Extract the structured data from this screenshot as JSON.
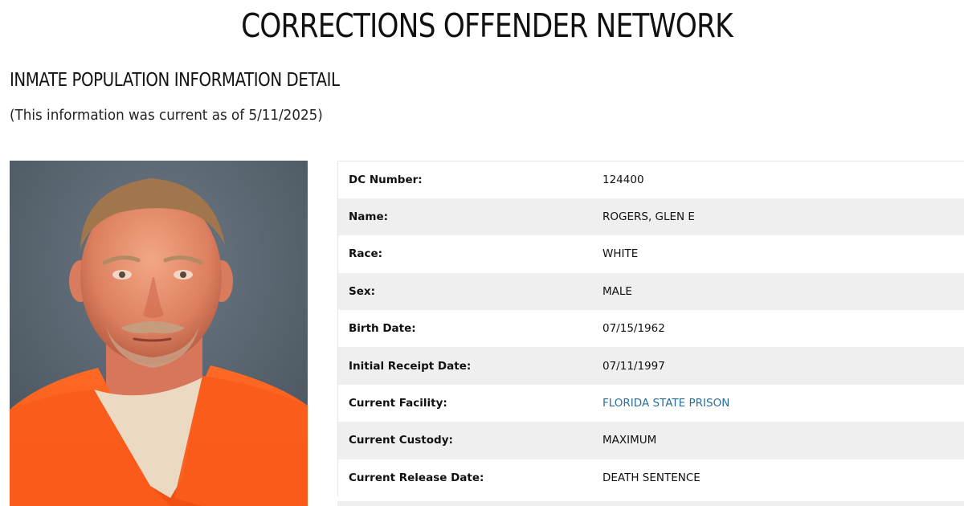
{
  "header": {
    "site_title": "CORRECTIONS OFFENDER NETWORK"
  },
  "section": {
    "heading": "INMATE POPULATION INFORMATION DETAIL",
    "current_note": "(This information was current as of 5/11/2025)"
  },
  "colors": {
    "link": "#2a6f99",
    "row_alt": "#efefef",
    "jumpsuit": "#ff5a1a"
  },
  "details": [
    {
      "label": "DC Number:",
      "value": "124400"
    },
    {
      "label": "Name:",
      "value": "ROGERS, GLEN E"
    },
    {
      "label": "Race:",
      "value": "WHITE"
    },
    {
      "label": "Sex:",
      "value": "MALE"
    },
    {
      "label": "Birth Date:",
      "value": "07/15/1962"
    },
    {
      "label": "Initial Receipt Date:",
      "value": "07/11/1997"
    },
    {
      "label": "Current Facility:",
      "value": "FLORIDA STATE PRISON"
    },
    {
      "label": "Current Custody:",
      "value": "MAXIMUM"
    },
    {
      "label": "Current Release Date:",
      "value": "DEATH SENTENCE"
    }
  ]
}
